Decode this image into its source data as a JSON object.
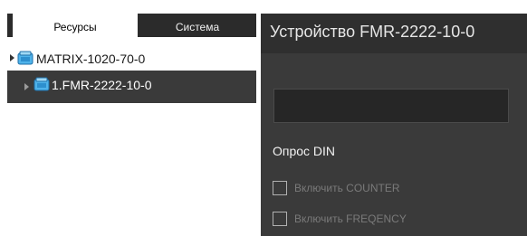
{
  "tabs": {
    "resources": "Ресурсы",
    "system": "Система"
  },
  "tree": {
    "items": [
      {
        "label": "MATRIX-1020-70-0",
        "icon": "device-icon"
      },
      {
        "label": "1.FMR-2222-10-0",
        "icon": "device-icon"
      }
    ]
  },
  "device": {
    "title": "Устройство FMR-2222-10-0",
    "name_value": ""
  },
  "din_section": {
    "title": "Опрос DIN",
    "counter_label": "Включить COUNTER",
    "counter_checked": false,
    "frequency_label": "Включить FREQENCY",
    "frequency_checked": false
  },
  "colors": {
    "panel_bg": "#3a3a3a",
    "tab_bar_bg": "#2b2b2b",
    "selected_row_bg": "#3a3a3a",
    "device_icon_accent": "#3aa0e0"
  }
}
